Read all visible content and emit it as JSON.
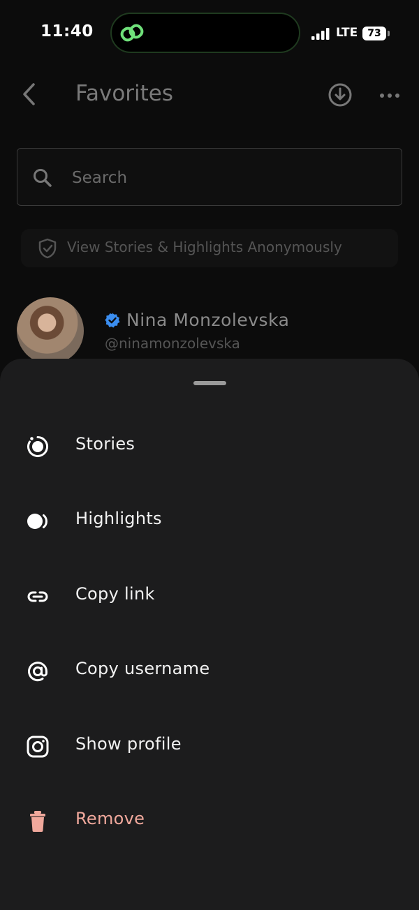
{
  "status_bar": {
    "time": "11:40",
    "network": "LTE",
    "battery": "73"
  },
  "header": {
    "title": "Favorites"
  },
  "search": {
    "placeholder": "Search"
  },
  "banner": {
    "label": "View Stories & Highlights Anonymously"
  },
  "profile": {
    "name": "Nina Monzolevska",
    "handle": "@ninamonzolevska"
  },
  "sheet": {
    "items": [
      {
        "label": "Stories",
        "icon": "stories-icon"
      },
      {
        "label": "Highlights",
        "icon": "highlights-icon"
      },
      {
        "label": "Copy link",
        "icon": "link-icon"
      },
      {
        "label": "Copy username",
        "icon": "at-icon"
      },
      {
        "label": "Show profile",
        "icon": "instagram-icon"
      },
      {
        "label": "Remove",
        "icon": "trash-icon"
      }
    ]
  },
  "colors": {
    "danger": "#f0a89c",
    "verified": "#3b8ef0",
    "app_accent": "#6fe07a"
  }
}
